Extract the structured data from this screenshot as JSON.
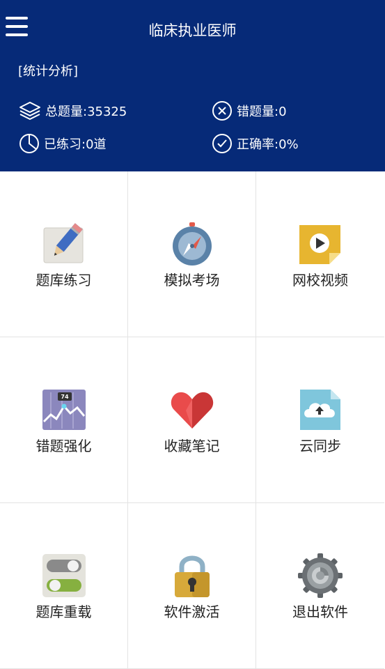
{
  "header": {
    "title": "临床执业医师",
    "section_label": "[统计分析]",
    "stats": {
      "total": "总题量:35325",
      "wrong": "错题量:0",
      "practiced": "已练习:0道",
      "accuracy": "正确率:0%"
    }
  },
  "menu": [
    {
      "label": "题库练习",
      "icon": "pencil-paper-icon"
    },
    {
      "label": "模拟考场",
      "icon": "compass-icon"
    },
    {
      "label": "网校视频",
      "icon": "video-play-icon"
    },
    {
      "label": "错题强化",
      "icon": "chart-icon"
    },
    {
      "label": "收藏笔记",
      "icon": "heart-icon"
    },
    {
      "label": "云同步",
      "icon": "cloud-upload-icon"
    },
    {
      "label": "题库重载",
      "icon": "toggle-switch-icon"
    },
    {
      "label": "软件激活",
      "icon": "padlock-icon"
    },
    {
      "label": "退出软件",
      "icon": "gear-icon"
    }
  ],
  "colors": {
    "header_bg": "#062a78",
    "grid_line": "#e3e3e3"
  },
  "chart_icon_value": "74"
}
